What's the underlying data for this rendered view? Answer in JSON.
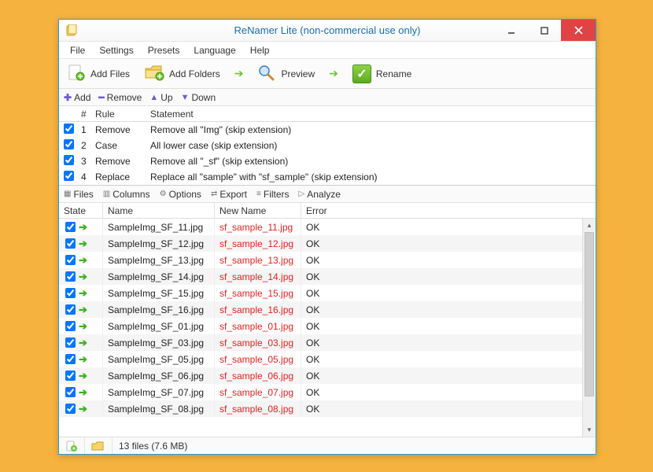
{
  "window": {
    "title": "ReNamer Lite (non-commercial use only)"
  },
  "menu": {
    "file": "File",
    "settings": "Settings",
    "presets": "Presets",
    "language": "Language",
    "help": "Help"
  },
  "toolbar": {
    "add_files": "Add Files",
    "add_folders": "Add Folders",
    "preview": "Preview",
    "rename": "Rename"
  },
  "rules_toolbar": {
    "add": "Add",
    "remove": "Remove",
    "up": "Up",
    "down": "Down"
  },
  "rules_header": {
    "num": "#",
    "rule": "Rule",
    "statement": "Statement"
  },
  "rules": [
    {
      "checked": true,
      "n": "1",
      "rule": "Remove",
      "statement": "Remove all \"Img\" (skip extension)"
    },
    {
      "checked": true,
      "n": "2",
      "rule": "Case",
      "statement": "All lower case (skip extension)"
    },
    {
      "checked": true,
      "n": "3",
      "rule": "Remove",
      "statement": "Remove all \"_sf\" (skip extension)"
    },
    {
      "checked": true,
      "n": "4",
      "rule": "Replace",
      "statement": "Replace all \"sample\" with \"sf_sample\" (skip extension)"
    }
  ],
  "files_toolbar": {
    "files": "Files",
    "columns": "Columns",
    "options": "Options",
    "export": "Export",
    "filters": "Filters",
    "analyze": "Analyze"
  },
  "files_header": {
    "state": "State",
    "name": "Name",
    "newname": "New Name",
    "error": "Error"
  },
  "files": [
    {
      "checked": true,
      "name": "SampleImg_SF_11.jpg",
      "newname": "sf_sample_11.jpg",
      "error": "OK"
    },
    {
      "checked": true,
      "name": "SampleImg_SF_12.jpg",
      "newname": "sf_sample_12.jpg",
      "error": "OK"
    },
    {
      "checked": true,
      "name": "SampleImg_SF_13.jpg",
      "newname": "sf_sample_13.jpg",
      "error": "OK"
    },
    {
      "checked": true,
      "name": "SampleImg_SF_14.jpg",
      "newname": "sf_sample_14.jpg",
      "error": "OK"
    },
    {
      "checked": true,
      "name": "SampleImg_SF_15.jpg",
      "newname": "sf_sample_15.jpg",
      "error": "OK"
    },
    {
      "checked": true,
      "name": "SampleImg_SF_16.jpg",
      "newname": "sf_sample_16.jpg",
      "error": "OK"
    },
    {
      "checked": true,
      "name": "SampleImg_SF_01.jpg",
      "newname": "sf_sample_01.jpg",
      "error": "OK"
    },
    {
      "checked": true,
      "name": "SampleImg_SF_03.jpg",
      "newname": "sf_sample_03.jpg",
      "error": "OK"
    },
    {
      "checked": true,
      "name": "SampleImg_SF_05.jpg",
      "newname": "sf_sample_05.jpg",
      "error": "OK"
    },
    {
      "checked": true,
      "name": "SampleImg_SF_06.jpg",
      "newname": "sf_sample_06.jpg",
      "error": "OK"
    },
    {
      "checked": true,
      "name": "SampleImg_SF_07.jpg",
      "newname": "sf_sample_07.jpg",
      "error": "OK"
    },
    {
      "checked": true,
      "name": "SampleImg_SF_08.jpg",
      "newname": "sf_sample_08.jpg",
      "error": "OK"
    }
  ],
  "status": {
    "text": "13 files (7.6 MB)"
  }
}
